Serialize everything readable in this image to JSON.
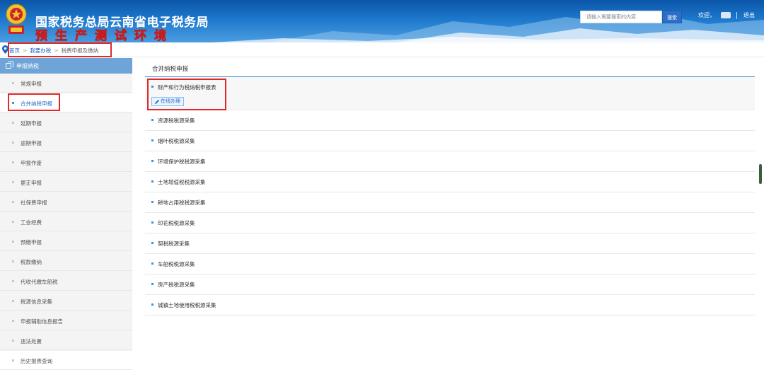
{
  "header": {
    "title": "国家税务总局云南省电子税务局",
    "subtitle": "预生产测试环境",
    "search_placeholder": "请输入需要搜索的内容",
    "search_button": "搜索",
    "welcome": "欢迎，",
    "logout": "退出"
  },
  "breadcrumb": {
    "home": "首页",
    "separator": ">",
    "level2": "我要办税",
    "current": "税费申报及缴纳"
  },
  "sidebar": {
    "header": "申报纳税",
    "items": [
      {
        "label": "常规申报"
      },
      {
        "label": "合并纳税申报"
      },
      {
        "label": "延期申报"
      },
      {
        "label": "逾期申报"
      },
      {
        "label": "申报作废"
      },
      {
        "label": "更正申报"
      },
      {
        "label": "社保费申报"
      },
      {
        "label": "工会经费"
      },
      {
        "label": "预缴申报"
      },
      {
        "label": "税款缴纳"
      },
      {
        "label": "代收代缴车船税"
      },
      {
        "label": "税源信息采集"
      },
      {
        "label": "申报辅助信息报告"
      },
      {
        "label": "违法处置"
      },
      {
        "label": "历史报表查询"
      }
    ],
    "active_index": 1
  },
  "main": {
    "title": "合并纳税申报",
    "online_button": "在线办理",
    "rows": [
      {
        "label": "财产和行为税纳税申报表"
      },
      {
        "label": "资源税税源采集"
      },
      {
        "label": "烟叶税税源采集"
      },
      {
        "label": "环境保护税税源采集"
      },
      {
        "label": "土地增值税税源采集"
      },
      {
        "label": "耕地占用税税源采集"
      },
      {
        "label": "印花税税源采集"
      },
      {
        "label": "契税税源采集"
      },
      {
        "label": "车船税税源采集"
      },
      {
        "label": "房产税税源采集"
      },
      {
        "label": "城镇土地使用税税源采集"
      }
    ]
  },
  "colors": {
    "accent": "#2b6fc9",
    "highlight_box": "#e02a2a",
    "sidebar_header": "#6ea4d8"
  }
}
